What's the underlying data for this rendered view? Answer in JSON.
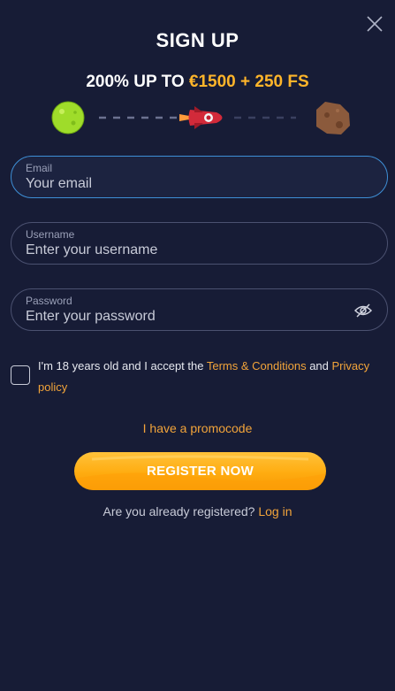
{
  "header": {
    "title": "SIGN UP",
    "bonus_prefix": "200% UP TO ",
    "bonus_highlight": "€1500 + 250 FS"
  },
  "icons": {
    "close": "close-icon",
    "planet_start": "planet-icon",
    "rocket": "rocket-icon",
    "planet_end": "asteroid-icon",
    "eye": "eye-off-icon"
  },
  "form": {
    "email": {
      "label": "Email",
      "placeholder": "Your email",
      "value": ""
    },
    "username": {
      "label": "Username",
      "placeholder": "Enter your username",
      "value": ""
    },
    "password": {
      "label": "Password",
      "placeholder": "Enter your password",
      "value": ""
    }
  },
  "terms": {
    "text_before": "I'm 18 years old and I accept the ",
    "terms_link": "Terms & Conditions",
    "text_middle": " and ",
    "privacy_link": "Privacy policy",
    "checked": false
  },
  "promo": {
    "label": "I have a promocode"
  },
  "register": {
    "label": "REGISTER NOW"
  },
  "login": {
    "question": "Are you already registered? ",
    "link": "Log in"
  },
  "colors": {
    "background": "#171c36",
    "accent": "#ffb52a",
    "link": "#f2a43a",
    "active_border": "#3e8fd6",
    "border": "#4b5170"
  }
}
